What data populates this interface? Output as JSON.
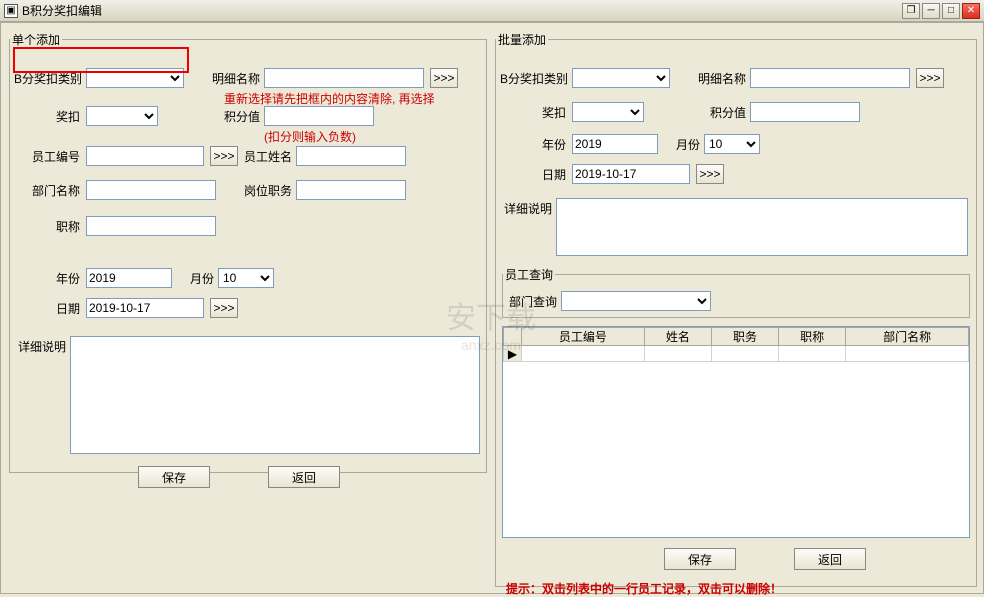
{
  "window": {
    "title": "B积分奖扣编辑"
  },
  "left": {
    "legend": "单个添加",
    "labels": {
      "category": "B分奖扣类别",
      "detail_name": "明细名称",
      "reward": "奖扣",
      "point_value": "积分值",
      "emp_no": "员工编号",
      "emp_name": "员工姓名",
      "dept_name": "部门名称",
      "position": "岗位职务",
      "title": "职称",
      "year": "年份",
      "month": "月份",
      "date": "日期",
      "desc": "详细说明"
    },
    "values": {
      "category": "",
      "detail_name": "",
      "reward": "",
      "point_value": "",
      "emp_no": "",
      "emp_name": "",
      "dept_name": "",
      "position": "",
      "title": "",
      "year": "2019",
      "month": "10",
      "date": "2019-10-17",
      "desc": ""
    },
    "notes": {
      "reselect": "重新选择请先把框内的内容清除, 再选择",
      "negative": "(扣分则输入负数)"
    },
    "buttons": {
      "save": "保存",
      "back": "返回",
      "more": ">>>"
    }
  },
  "right": {
    "legend": "批量添加",
    "labels": {
      "category": "B分奖扣类别",
      "detail_name": "明细名称",
      "reward": "奖扣",
      "point_value": "积分值",
      "year": "年份",
      "month": "月份",
      "date": "日期",
      "desc": "详细说明"
    },
    "values": {
      "category": "",
      "detail_name": "",
      "reward": "",
      "point_value": "",
      "year": "2019",
      "month": "10",
      "date": "2019-10-17",
      "desc": ""
    },
    "query": {
      "legend": "员工查询",
      "dept_label": "部门查询",
      "dept_value": ""
    },
    "table": {
      "headers": [
        "员工编号",
        "姓名",
        "职务",
        "职称",
        "部门名称"
      ]
    },
    "buttons": {
      "save": "保存",
      "back": "返回",
      "more": ">>>"
    },
    "tip": "提示：双击列表中的一行员工记录，双击可以删除！"
  },
  "watermark": {
    "text": "安下载",
    "sub": "anxz.com"
  }
}
